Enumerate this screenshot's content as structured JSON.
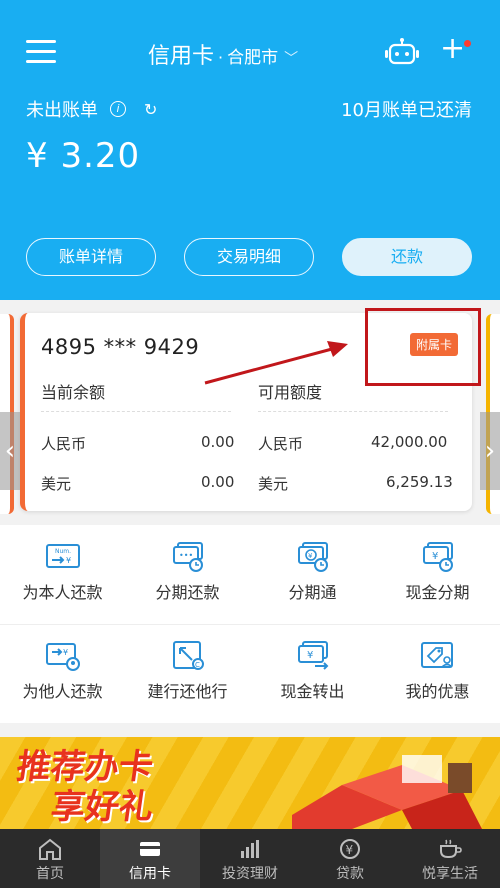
{
  "header": {
    "title": "信用卡",
    "dot": "·",
    "city": "合肥市",
    "unbilled_label": "未出账单",
    "repaid_status": "10月账单已还清",
    "amount": "¥ 3.20",
    "buttons": [
      "账单详情",
      "交易明细",
      "还款"
    ]
  },
  "card": {
    "number": "4895 *** 9429",
    "badge": "附属卡",
    "current_balance_label": "当前余额",
    "available_credit_label": "可用额度",
    "rows": [
      {
        "currency": "人民币",
        "balance": "0.00",
        "credit_currency": "人民币",
        "credit": "42,000.00"
      },
      {
        "currency": "美元",
        "balance": "0.00",
        "credit_currency": "美元",
        "credit": "6,259.13"
      }
    ]
  },
  "services": [
    {
      "label": "为本人还款",
      "icon": "self-repay-icon"
    },
    {
      "label": "分期还款",
      "icon": "installment-repay-icon"
    },
    {
      "label": "分期通",
      "icon": "installment-pass-icon"
    },
    {
      "label": "现金分期",
      "icon": "cash-installment-icon"
    },
    {
      "label": "为他人还款",
      "icon": "others-repay-icon"
    },
    {
      "label": "建行还他行",
      "icon": "ccb-repay-other-bank-icon"
    },
    {
      "label": "现金转出",
      "icon": "cash-transfer-icon"
    },
    {
      "label": "我的优惠",
      "icon": "my-offers-icon"
    }
  ],
  "banner": {
    "line1": "推荐办卡",
    "line2": "享好礼"
  },
  "tabs": [
    {
      "label": "首页",
      "icon": "home-icon",
      "active": false
    },
    {
      "label": "信用卡",
      "icon": "credit-card-icon",
      "active": true
    },
    {
      "label": "投资理财",
      "icon": "investment-icon",
      "active": false
    },
    {
      "label": "贷款",
      "icon": "loan-icon",
      "active": false
    },
    {
      "label": "悦享生活",
      "icon": "lifestyle-icon",
      "active": false
    }
  ],
  "colors": {
    "header_blue": "#19aef2",
    "card_accent": "#f26a35",
    "highlight_red": "#c1171b",
    "tabbar": "#2b2b2b"
  }
}
